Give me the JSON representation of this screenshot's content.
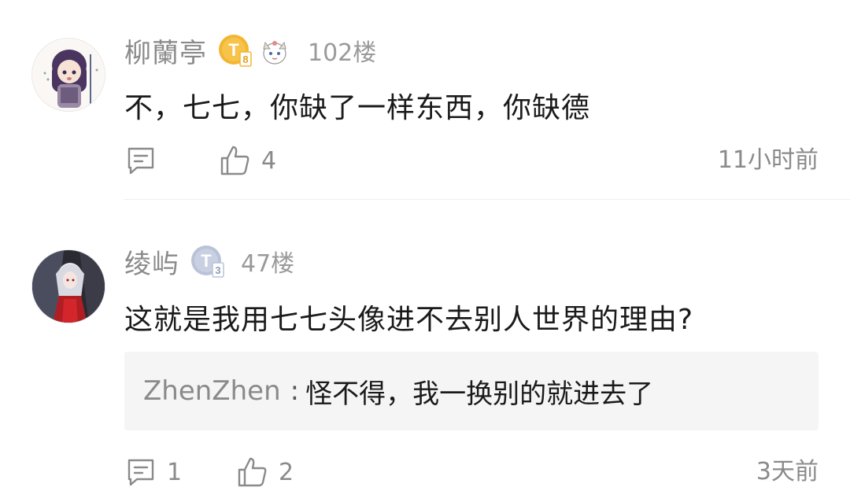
{
  "comments": [
    {
      "username": "柳蘭亭",
      "badge_letter": "T",
      "badge_level": "8",
      "floor": "102楼",
      "content": "不，七七，你缺了一样东西，你缺德",
      "reply_count": "",
      "like_count": "4",
      "time": "11小时前",
      "badge_color": "#f2b632"
    },
    {
      "username": "绫屿",
      "badge_letter": "T",
      "badge_level": "3",
      "floor": "47楼",
      "content": "这就是我用七七头像进不去别人世界的理由?",
      "reply": {
        "user": "ZhenZhen",
        "separator": ":",
        "text": "怪不得，我一换别的就进去了"
      },
      "reply_count": "1",
      "like_count": "2",
      "time": "3天前",
      "badge_color": "#b9c3d8"
    }
  ]
}
